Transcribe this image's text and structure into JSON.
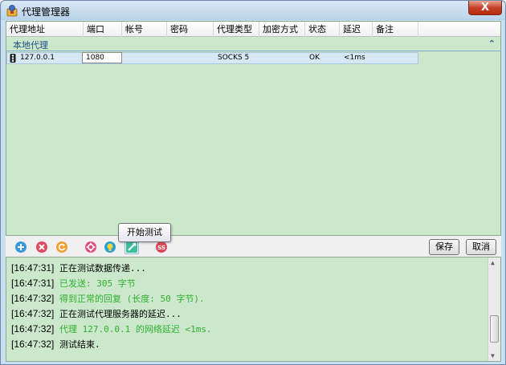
{
  "window": {
    "title": "代理管理器",
    "close_label": "X"
  },
  "grid": {
    "columns": [
      "代理地址",
      "端口",
      "帐号",
      "密码",
      "代理类型",
      "加密方式",
      "状态",
      "延迟",
      "备注"
    ],
    "group": {
      "label": "本地代理",
      "collapse_glyph": "⌃"
    },
    "rows": [
      {
        "address": "127.0.0.1",
        "port": "1080",
        "account": "",
        "password": "",
        "type": "SOCKS 5",
        "encryption": "",
        "status": "OK",
        "latency": "<1ms",
        "note": ""
      }
    ]
  },
  "toolbar": {
    "tooltip": "开始测试",
    "save_label": "保存",
    "cancel_label": "取消",
    "icons": [
      "add-icon",
      "delete-icon",
      "refresh-icon",
      "settings-icon",
      "info-icon",
      "start-test-icon",
      "ss-icon"
    ]
  },
  "log": {
    "colors": {
      "normal": "#000000",
      "success": "#2fb02f"
    },
    "lines": [
      {
        "time": "[16:47:31]",
        "text": "正在测试数据传递...",
        "kind": "normal"
      },
      {
        "time": "[16:47:31]",
        "text": "已发送: 305 字节",
        "kind": "success"
      },
      {
        "time": "[16:47:32]",
        "text": "得到正常的回复 (长度: 50 字节).",
        "kind": "success"
      },
      {
        "time": "[16:47:32]",
        "text": "正在测试代理服务器的延迟...",
        "kind": "normal"
      },
      {
        "time": "[16:47:32]",
        "text": "代理 127.0.0.1 的网络延迟 <1ms.",
        "kind": "success"
      },
      {
        "time": "[16:47:32]",
        "text": "测试结束.",
        "kind": "normal"
      }
    ]
  }
}
